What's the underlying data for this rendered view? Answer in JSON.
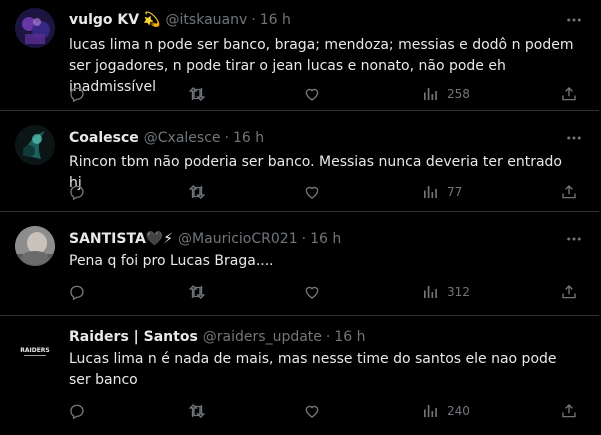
{
  "colors": {
    "background": "#000000",
    "text": "#e7e9ea",
    "muted": "#71767b",
    "divider": "#2f3336"
  },
  "tweets": [
    {
      "name": "vulgo KV",
      "badge_emoji": "💫",
      "handle": "@itskauanv",
      "dot": "·",
      "time": "16 h",
      "text": "lucas lima n pode ser banco, braga; mendoza; messias e dodô n podem ser jogadores, n pode tirar o jean lucas e nonato, não pode eh inadmissível",
      "views": "258"
    },
    {
      "name": "Coalesce",
      "handle": "@Cxalesce",
      "dot": "·",
      "time": "16 h",
      "text": "Rincon tbm não poderia ser banco. Messias nunca deveria ter entrado hj",
      "views": "77"
    },
    {
      "name": "SANTISTA🖤⚡",
      "handle": "@MauricioCR021",
      "dot": "·",
      "time": "16 h",
      "text": "Pena q foi pro Lucas Braga....",
      "views": "312"
    },
    {
      "name": "Raiders | Santos",
      "handle": "@raiders_update",
      "dot": "·",
      "time": "16 h",
      "text": "Lucas lima n é nada de mais, mas nesse time do santos ele nao pode ser banco",
      "views": "240",
      "avatar_logo_text": "RAIDERS"
    }
  ],
  "icons": {
    "reply": "reply-icon",
    "retweet": "retweet-icon",
    "like": "like-icon",
    "views": "views-icon",
    "share": "share-icon",
    "more": "more-icon"
  }
}
